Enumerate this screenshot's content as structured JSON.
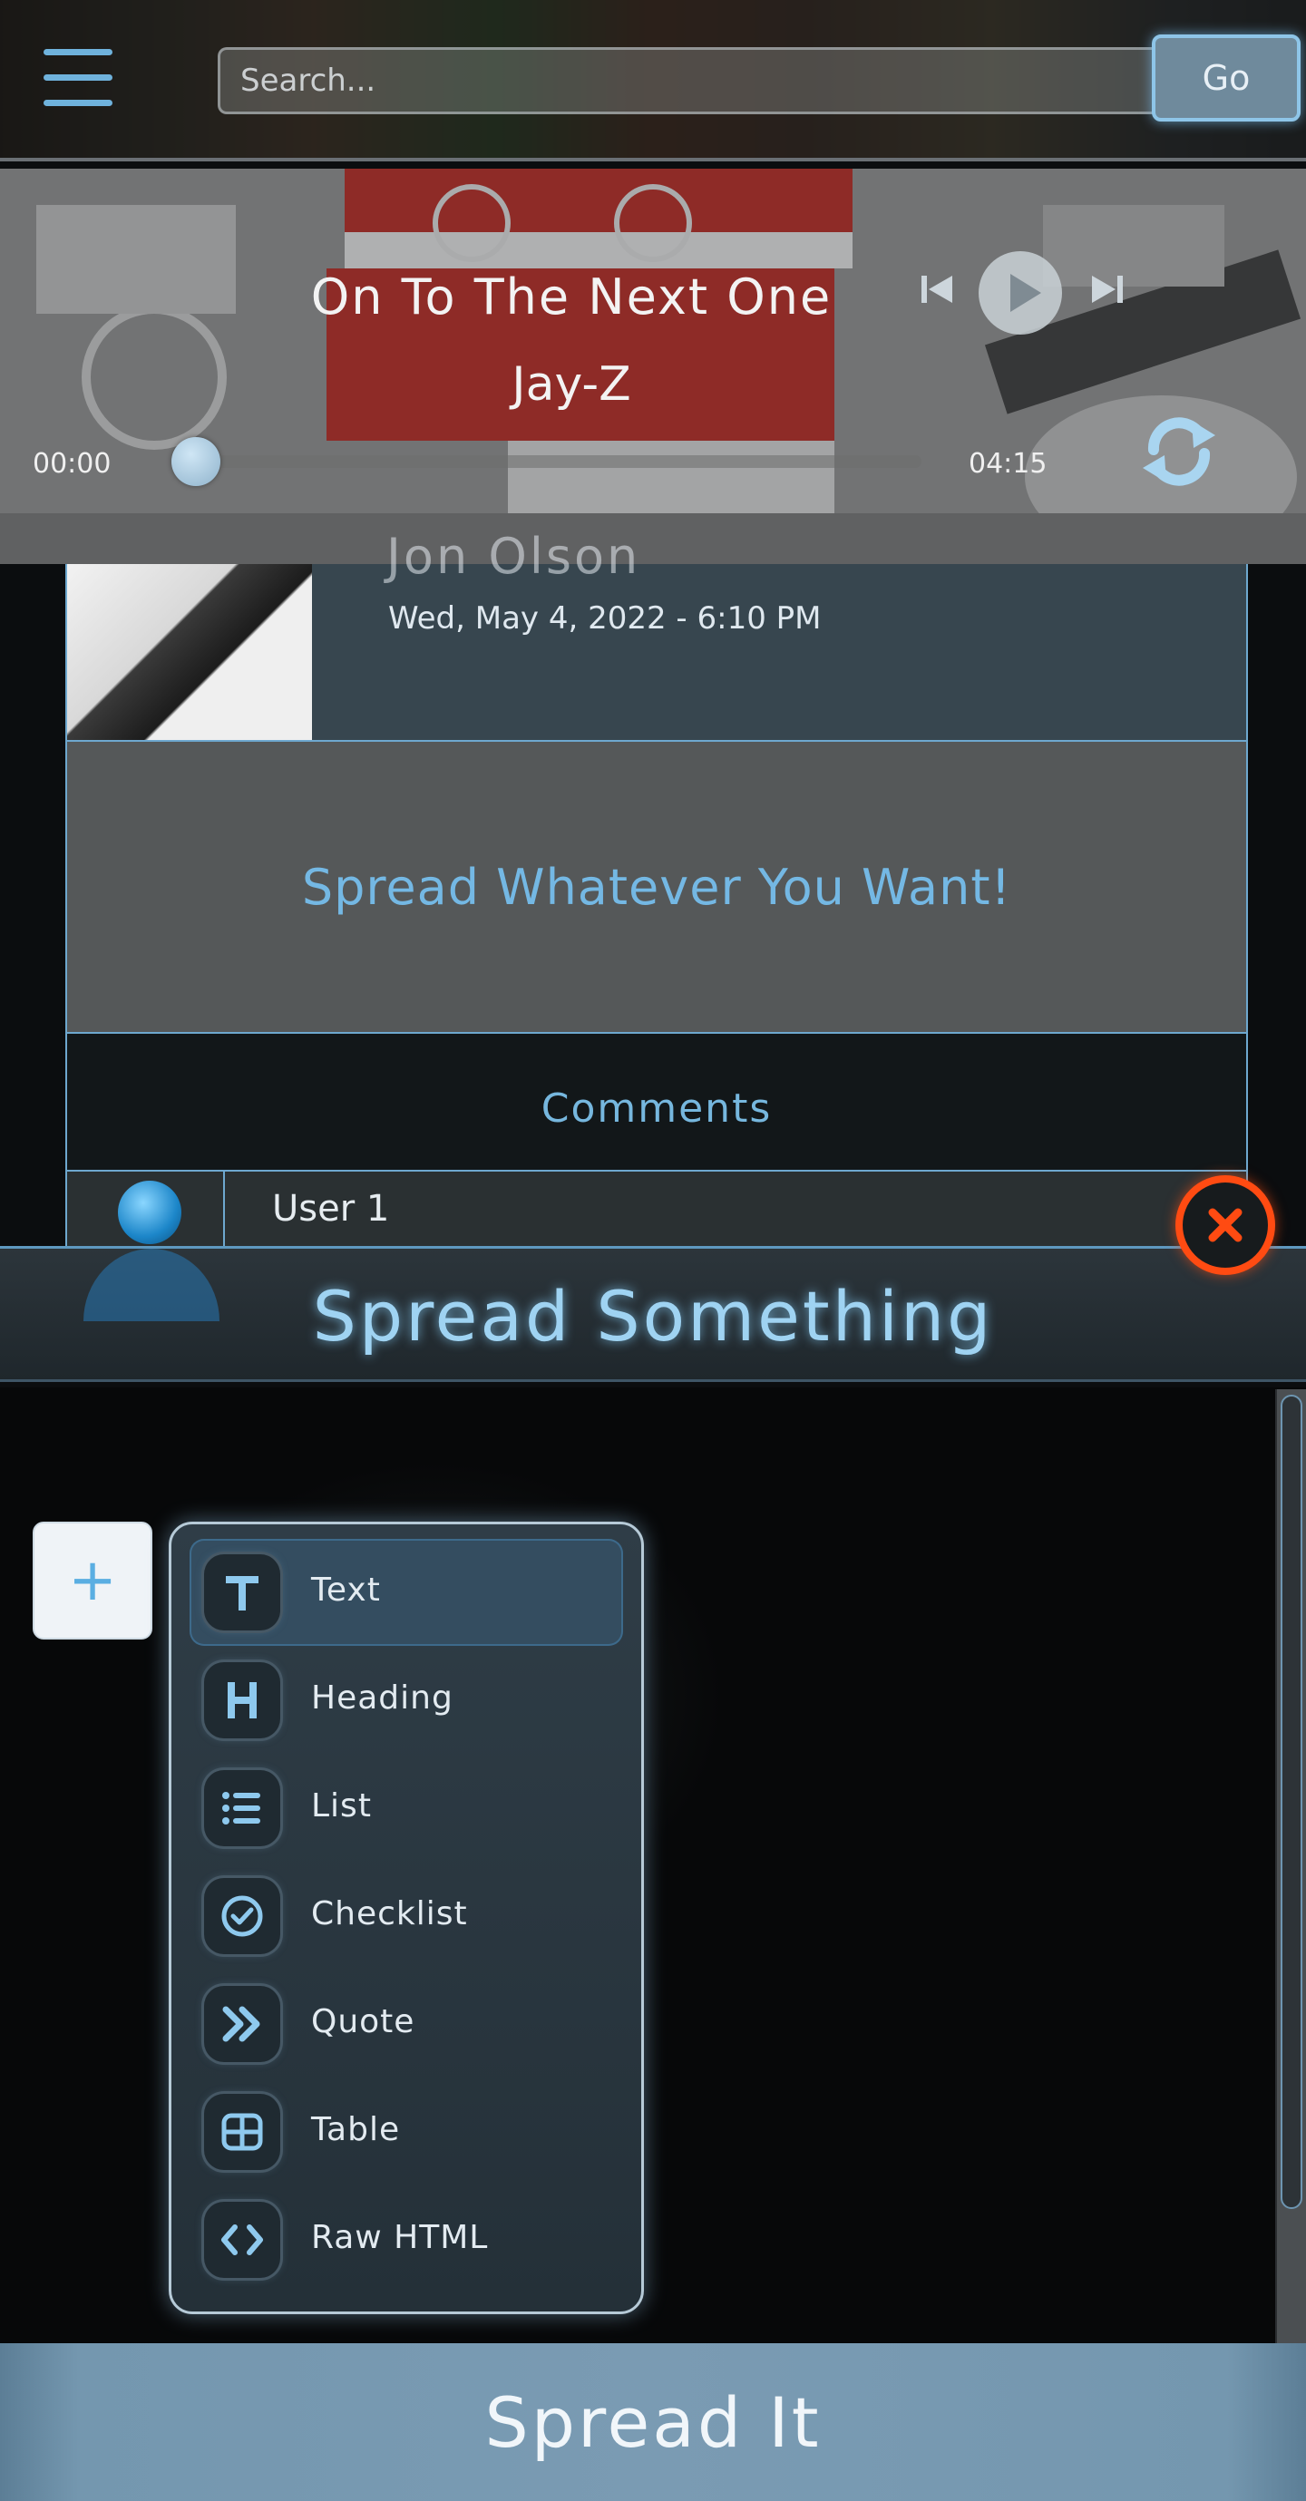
{
  "header": {
    "search_placeholder": "Search...",
    "go_label": "Go"
  },
  "player": {
    "title": "On To The Next One",
    "artist": "Jay-Z",
    "current_time": "00:00",
    "total_time": "04:15",
    "progress": 0.0
  },
  "post": {
    "author_name": "Jon Olson",
    "date": "Wed, May 4, 2022 - 6:10 PM",
    "body": "Spread Whatever You Want!",
    "comments_label": "Comments",
    "comments": [
      {
        "user": "User 1"
      }
    ]
  },
  "modal": {
    "title": "Spread Something",
    "add_label": "+",
    "menu": [
      {
        "label": "Text",
        "icon": "text-icon",
        "active": true
      },
      {
        "label": "Heading",
        "icon": "heading-icon",
        "active": false
      },
      {
        "label": "List",
        "icon": "list-icon",
        "active": false
      },
      {
        "label": "Checklist",
        "icon": "checklist-icon",
        "active": false
      },
      {
        "label": "Quote",
        "icon": "quote-icon",
        "active": false
      },
      {
        "label": "Table",
        "icon": "table-icon",
        "active": false
      },
      {
        "label": "Raw HTML",
        "icon": "code-icon",
        "active": false
      }
    ],
    "submit_label": "Spread It"
  },
  "colors": {
    "accent": "#74b8e4",
    "close": "#ff4b12"
  }
}
